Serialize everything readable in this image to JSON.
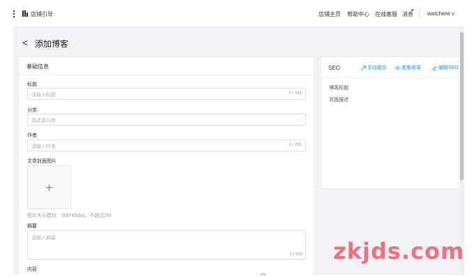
{
  "topbar": {
    "shop_title": "店铺引导",
    "nav": [
      "店铺主页",
      "帮助中心",
      "在线客服",
      "消息"
    ],
    "user": "watchere",
    "user_chevron": "∨"
  },
  "page": {
    "back_glyph": "<",
    "title": "添加博客"
  },
  "basic": {
    "header": "基础信息",
    "title_label": "标题",
    "title_placeholder": "请输入标题",
    "title_count": "0 / 255",
    "category_label": "分类",
    "category_placeholder": "请选择分类",
    "author_label": "作者",
    "author_placeholder": "请输入作者",
    "author_count": "0 / 255",
    "cover_label": "文章封面图片",
    "cover_plus": "+",
    "cover_hint": "图片大小建议：600*450px，不超过2M",
    "summary_label": "摘要",
    "summary_placeholder": "请输入摘要",
    "summary_count": "0 / 500",
    "content_label": "内容"
  },
  "seo": {
    "header": "SEO",
    "manual_submit": "手动提交",
    "view_index": "查看收录",
    "edit_seo": "编辑SEO",
    "blog_title_label": "博客标题",
    "page_desc_label": "页面描述"
  },
  "watermark": "zkjds.com",
  "icons": [
    "menu-dots-icon",
    "shop-icon",
    "chevron-down-icon",
    "back-arrow-icon",
    "plus-icon",
    "send-icon",
    "eye-icon",
    "edit-icon",
    "caret-up-icon"
  ],
  "colors": {
    "accent": "#1890ff",
    "background": "#f0f2f5",
    "notice_dot": "#f5222d",
    "watermark": "#f07080"
  }
}
